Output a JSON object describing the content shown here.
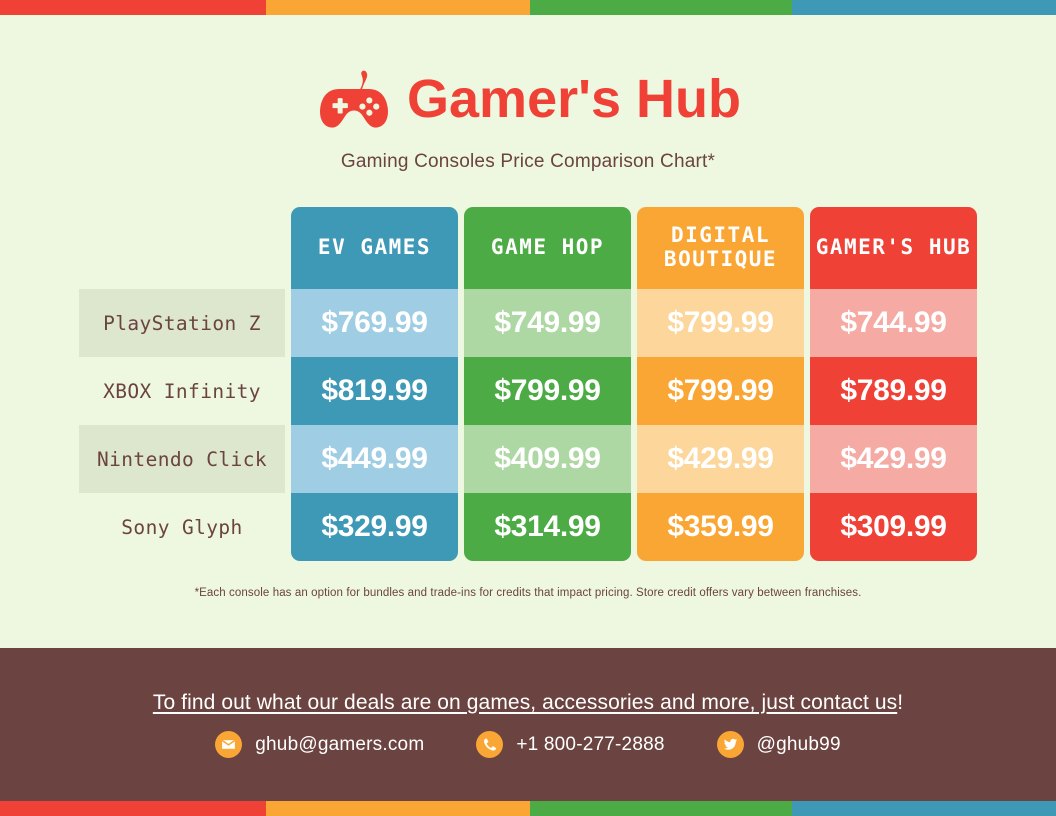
{
  "theme": {
    "page_bg": "#eef8e0",
    "brand_red": "#ef4136",
    "brand_orange": "#faa634",
    "brand_green": "#4cab44",
    "brand_blue": "#3e99b7",
    "footer_brown": "#6b4340"
  },
  "top_bar": {
    "segments": [
      {
        "name": "red",
        "color": "#ef4136"
      },
      {
        "name": "orange",
        "color": "#faa634"
      },
      {
        "name": "green",
        "color": "#4cab44"
      },
      {
        "name": "blue",
        "color": "#3e99b7"
      }
    ]
  },
  "header": {
    "logo_icon": "game-controller-icon",
    "title": "Gamer's Hub",
    "subtitle": "Gaming Consoles Price Comparison Chart*"
  },
  "chart_data": {
    "type": "table",
    "title": "Gaming Consoles Price Comparison Chart*",
    "columns": [
      "",
      "EV GAMES",
      "GAME HOP",
      "DIGITAL BOUTIQUE",
      "GAMER'S HUB"
    ],
    "column_colors": [
      "",
      "#3e99b7",
      "#4cab44",
      "#faa634",
      "#ef4136"
    ],
    "rows": [
      {
        "label": "PlayStation Z",
        "values": [
          "$769.99",
          "$749.99",
          "$799.99",
          "$744.99"
        ]
      },
      {
        "label": "XBOX Infinity",
        "values": [
          "$819.99",
          "$799.99",
          "$799.99",
          "$789.99"
        ]
      },
      {
        "label": "Nintendo Click",
        "values": [
          "$449.99",
          "$409.99",
          "$429.99",
          "$429.99"
        ]
      },
      {
        "label": "Sony Glyph",
        "values": [
          "$329.99",
          "$314.99",
          "$359.99",
          "$309.99"
        ]
      }
    ],
    "footnote": "*Each console has an option for bundles and trade-ins for credits that impact pricing. Store credit offers vary between franchises."
  },
  "table": {
    "headers": {
      "col1": "EV GAMES",
      "col2": "GAME HOP",
      "col3_line1": "DIGITAL",
      "col3_line2": "BOUTIQUE",
      "col4": "GAMER'S HUB"
    },
    "rows": [
      {
        "label": "PlayStation Z",
        "p1": "$769.99",
        "p2": "$749.99",
        "p3": "$799.99",
        "p4": "$744.99"
      },
      {
        "label": "XBOX Infinity",
        "p1": "$819.99",
        "p2": "$799.99",
        "p3": "$799.99",
        "p4": "$789.99"
      },
      {
        "label": "Nintendo Click",
        "p1": "$449.99",
        "p2": "$409.99",
        "p3": "$429.99",
        "p4": "$429.99"
      },
      {
        "label": "Sony Glyph",
        "p1": "$329.99",
        "p2": "$314.99",
        "p3": "$359.99",
        "p4": "$309.99"
      }
    ]
  },
  "footnote": "*Each console has an option for bundles and trade-ins for credits that impact pricing. Store credit offers vary between franchises.",
  "footer": {
    "cta_underlined": "To find out what our deals are on games, accessories and more, just contact us",
    "cta_tail": "!",
    "contacts": [
      {
        "icon": "email-icon",
        "text": "ghub@gamers.com"
      },
      {
        "icon": "phone-icon",
        "text": "+1 800-277-2888"
      },
      {
        "icon": "twitter-icon",
        "text": "@ghub99"
      }
    ]
  }
}
